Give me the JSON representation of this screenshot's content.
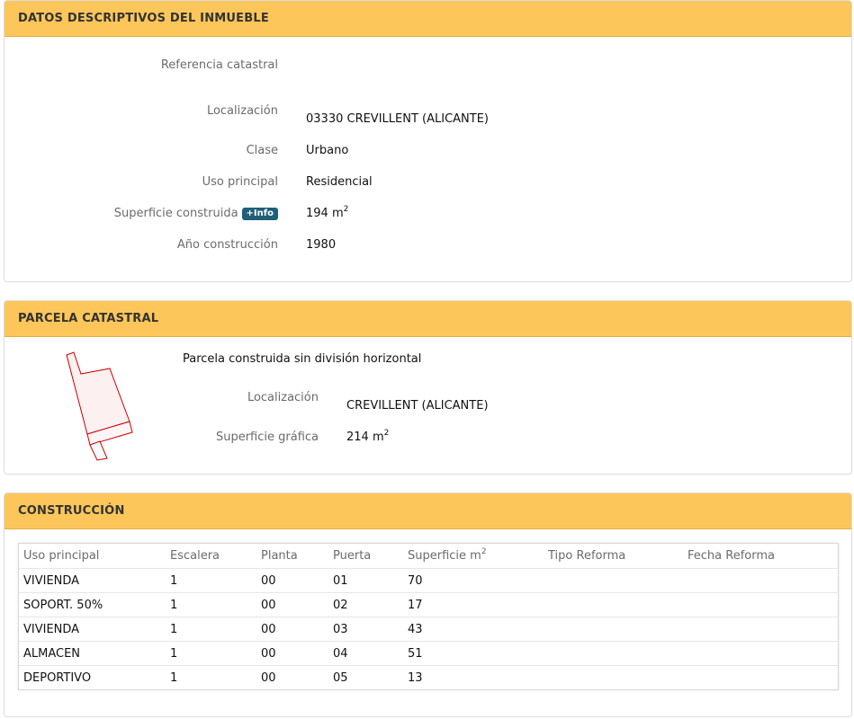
{
  "datos": {
    "title": "DATOS DESCRIPTIVOS DEL INMUEBLE",
    "ref_label": "Referencia catastral",
    "ref_value": "",
    "loc_label": "Localización",
    "loc_value": "03330 CREVILLENT (ALICANTE)",
    "clase_label": "Clase",
    "clase_value": "Urbano",
    "uso_label": "Uso principal",
    "uso_value": "Residencial",
    "sup_label": "Superficie construida",
    "info_badge": "+Info",
    "sup_value": "194 m",
    "sup_unit_sup": "2",
    "anio_label": "Año construcción",
    "anio_value": "1980"
  },
  "parcela": {
    "title": "PARCELA CATASTRAL",
    "desc": "Parcela construida sin división horizontal",
    "loc_label": "Localización",
    "loc_value": "CREVILLENT (ALICANTE)",
    "sup_label": "Superficie gráfica",
    "sup_value": "214 m",
    "sup_unit_sup": "2",
    "map_color": "#cc0000"
  },
  "construccion": {
    "title": "CONSTRUCCIÓN",
    "headers": [
      "Uso principal",
      "Escalera",
      "Planta",
      "Puerta",
      "Superficie m",
      "Tipo Reforma",
      "Fecha Reforma"
    ],
    "header_sup": "2",
    "rows": [
      [
        "VIVIENDA",
        "1",
        "00",
        "01",
        "70",
        "",
        ""
      ],
      [
        "SOPORT. 50%",
        "1",
        "00",
        "02",
        "17",
        "",
        ""
      ],
      [
        "VIVIENDA",
        "1",
        "00",
        "03",
        "43",
        "",
        ""
      ],
      [
        "ALMACEN",
        "1",
        "00",
        "04",
        "51",
        "",
        ""
      ],
      [
        "DEPORTIVO",
        "1",
        "00",
        "05",
        "13",
        "",
        ""
      ]
    ]
  },
  "colors": {
    "header_bg": "#fcc65a",
    "badge_bg": "#1f5f7a"
  }
}
